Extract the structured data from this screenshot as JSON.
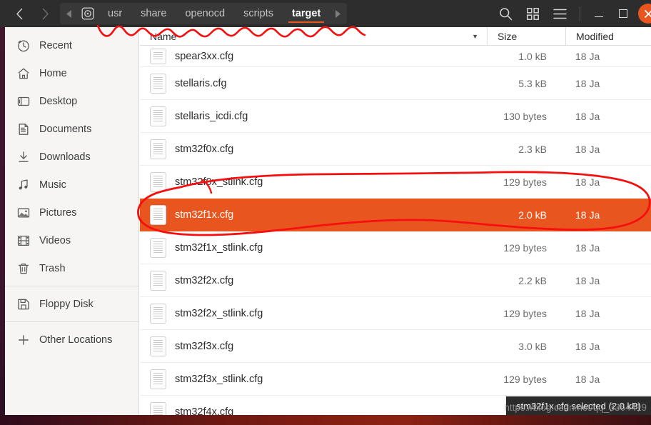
{
  "window": {
    "title": "target",
    "nav": {
      "back_icon": "chevron-left-icon",
      "forward_icon": "chevron-right-icon"
    },
    "controls": {
      "minimize_label": "—",
      "maximize_label": "□",
      "close_label": "×"
    },
    "actions": {
      "search_icon": "search-icon",
      "view_grid_icon": "grid-view-icon",
      "menu_icon": "hamburger-menu-icon"
    }
  },
  "breadcrumb": {
    "left_arrow": "◀",
    "right_arrow": "▶",
    "disk_icon": "filesystem-disk-icon",
    "items": [
      {
        "label": "usr",
        "active": false
      },
      {
        "label": "share",
        "active": false
      },
      {
        "label": "openocd",
        "active": false
      },
      {
        "label": "scripts",
        "active": false
      },
      {
        "label": "target",
        "active": true
      }
    ]
  },
  "sidebar": {
    "items": [
      {
        "label": "Recent",
        "icon": "clock-icon"
      },
      {
        "label": "Home",
        "icon": "home-icon"
      },
      {
        "label": "Desktop",
        "icon": "desktop-icon"
      },
      {
        "label": "Documents",
        "icon": "document-icon"
      },
      {
        "label": "Downloads",
        "icon": "download-icon"
      },
      {
        "label": "Music",
        "icon": "music-note-icon"
      },
      {
        "label": "Pictures",
        "icon": "picture-icon"
      },
      {
        "label": "Videos",
        "icon": "film-icon"
      },
      {
        "label": "Trash",
        "icon": "trash-icon"
      }
    ],
    "devices": [
      {
        "label": "Floppy Disk",
        "icon": "floppy-disk-icon"
      }
    ],
    "other": [
      {
        "label": "Other Locations",
        "icon": "plus-icon"
      }
    ]
  },
  "columns": {
    "name": "Name",
    "size": "Size",
    "modified": "Modified",
    "sort_indicator": "▼"
  },
  "files": [
    {
      "name": "spear3xx.cfg",
      "size": "1.0 kB",
      "modified": "18 Ja",
      "selected": false
    },
    {
      "name": "stellaris.cfg",
      "size": "5.3 kB",
      "modified": "18 Ja",
      "selected": false
    },
    {
      "name": "stellaris_icdi.cfg",
      "size": "130 bytes",
      "modified": "18 Ja",
      "selected": false
    },
    {
      "name": "stm32f0x.cfg",
      "size": "2.3 kB",
      "modified": "18 Ja",
      "selected": false
    },
    {
      "name": "stm32f0x_stlink.cfg",
      "size": "129 bytes",
      "modified": "18 Ja",
      "selected": false
    },
    {
      "name": "stm32f1x.cfg",
      "size": "2.0 kB",
      "modified": "18 Ja",
      "selected": true
    },
    {
      "name": "stm32f1x_stlink.cfg",
      "size": "129 bytes",
      "modified": "18 Ja",
      "selected": false
    },
    {
      "name": "stm32f2x.cfg",
      "size": "2.2 kB",
      "modified": "18 Ja",
      "selected": false
    },
    {
      "name": "stm32f2x_stlink.cfg",
      "size": "129 bytes",
      "modified": "18 Ja",
      "selected": false
    },
    {
      "name": "stm32f3x.cfg",
      "size": "3.0 kB",
      "modified": "18 Ja",
      "selected": false
    },
    {
      "name": "stm32f3x_stlink.cfg",
      "size": "129 bytes",
      "modified": "18 Ja",
      "selected": false
    },
    {
      "name": "stm32f4x.cfg",
      "size": "",
      "modified": "",
      "selected": false
    }
  ],
  "status": {
    "text": "stm32f1x.cfg selected (2.0 kB)"
  },
  "watermark": {
    "text": "https://blog.csdn.net/qq_3364419"
  },
  "colors": {
    "selection": "#e9551f",
    "headerbar": "#2d2d2d",
    "sidebar": "#f6f5f4",
    "annotation": "#f5100f",
    "close_button": "#e9551f"
  }
}
